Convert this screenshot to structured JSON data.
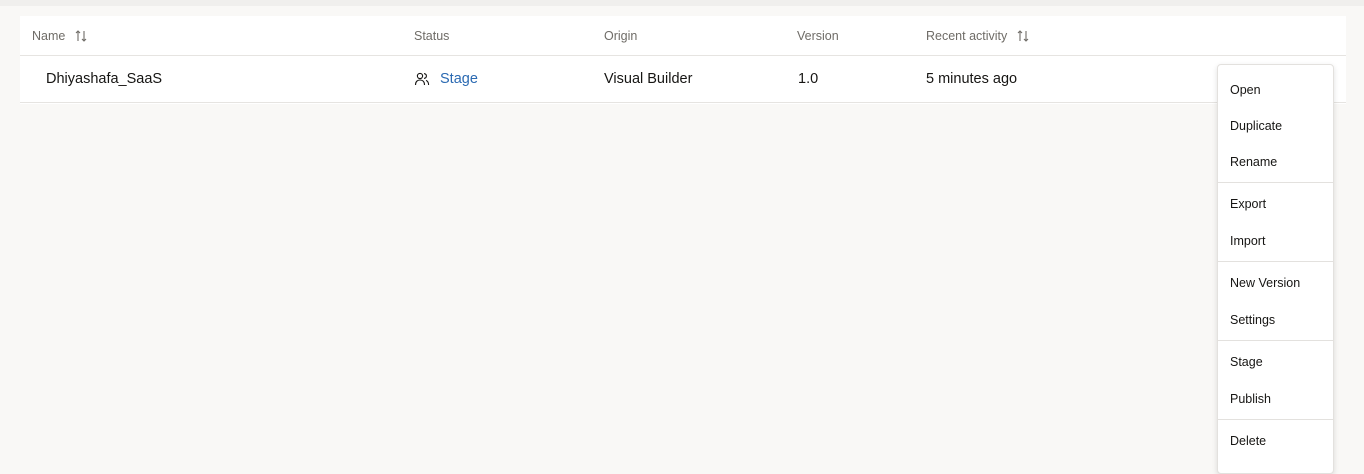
{
  "table": {
    "columns": {
      "name": "Name",
      "status": "Status",
      "origin": "Origin",
      "version": "Version",
      "recent_activity": "Recent activity"
    },
    "rows": [
      {
        "name": "Dhiyashafa_SaaS",
        "status": "Stage",
        "status_icon": "users-icon",
        "origin": "Visual Builder",
        "version": "1.0",
        "recent_activity": "5 minutes ago"
      }
    ]
  },
  "context_menu": {
    "groups": [
      [
        "Open",
        "Duplicate",
        "Rename"
      ],
      [
        "Export",
        "Import"
      ],
      [
        "New Version",
        "Settings"
      ],
      [
        "Stage",
        "Publish"
      ],
      [
        "Delete"
      ]
    ]
  },
  "colors": {
    "link": "#2b6ab2",
    "header_text": "#6f6c67",
    "background": "#f9f8f6"
  }
}
